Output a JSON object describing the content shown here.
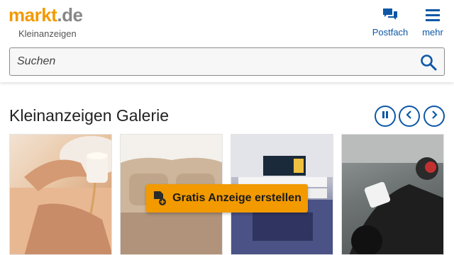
{
  "header": {
    "logo_brand": "markt",
    "logo_dot": ".",
    "logo_tld": "de",
    "tagline": "Kleinanzeigen",
    "postfach_label": "Postfach",
    "mehr_label": "mehr"
  },
  "search": {
    "placeholder": "Suchen"
  },
  "gallery": {
    "title": "Kleinanzeigen Galerie",
    "items": [
      {
        "icon": "massage-photo"
      },
      {
        "icon": "sofa-photo"
      },
      {
        "icon": "organ-photo"
      },
      {
        "icon": "motorcycle-photo"
      }
    ]
  },
  "cta": {
    "label": "Gratis Anzeige erstellen"
  },
  "colors": {
    "brand_orange": "#f29a00",
    "link_blue": "#0d57a6"
  }
}
